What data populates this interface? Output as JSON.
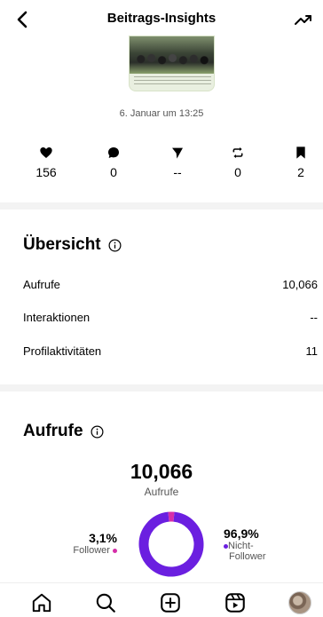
{
  "header": {
    "title": "Beitrags-Insights",
    "back_icon": "chevron-left-icon",
    "trend_icon": "trending-up-icon"
  },
  "post": {
    "date": "6. Januar um 13:25"
  },
  "stats": [
    {
      "icon": "heart-icon",
      "value": "156"
    },
    {
      "icon": "comment-icon",
      "value": "0"
    },
    {
      "icon": "send-icon",
      "value": "--"
    },
    {
      "icon": "repost-icon",
      "value": "0"
    },
    {
      "icon": "bookmark-icon",
      "value": "2"
    }
  ],
  "overview": {
    "title": "Übersicht",
    "rows": [
      {
        "label": "Aufrufe",
        "value": "10,066"
      },
      {
        "label": "Interaktionen",
        "value": "--"
      },
      {
        "label": "Profilaktivitäten",
        "value": "11"
      }
    ]
  },
  "views": {
    "title": "Aufrufe",
    "total": "10,066",
    "total_label": "Aufrufe",
    "follower_pct": "3,1%",
    "follower_label": "Follower",
    "nonfollower_pct": "96,9%",
    "nonfollower_label_line1": "Nicht-",
    "nonfollower_label_line2": "Follower",
    "colors": {
      "follower": "#d62ea8",
      "nonfollower": "#6b1fe0"
    }
  },
  "chart_data": {
    "type": "pie",
    "categories": [
      "Follower",
      "Nicht-Follower"
    ],
    "values": [
      3.1,
      96.9
    ]
  },
  "nav": [
    {
      "icon": "home-icon"
    },
    {
      "icon": "search-icon"
    },
    {
      "icon": "create-icon"
    },
    {
      "icon": "reels-icon"
    },
    {
      "icon": "profile-avatar"
    }
  ]
}
